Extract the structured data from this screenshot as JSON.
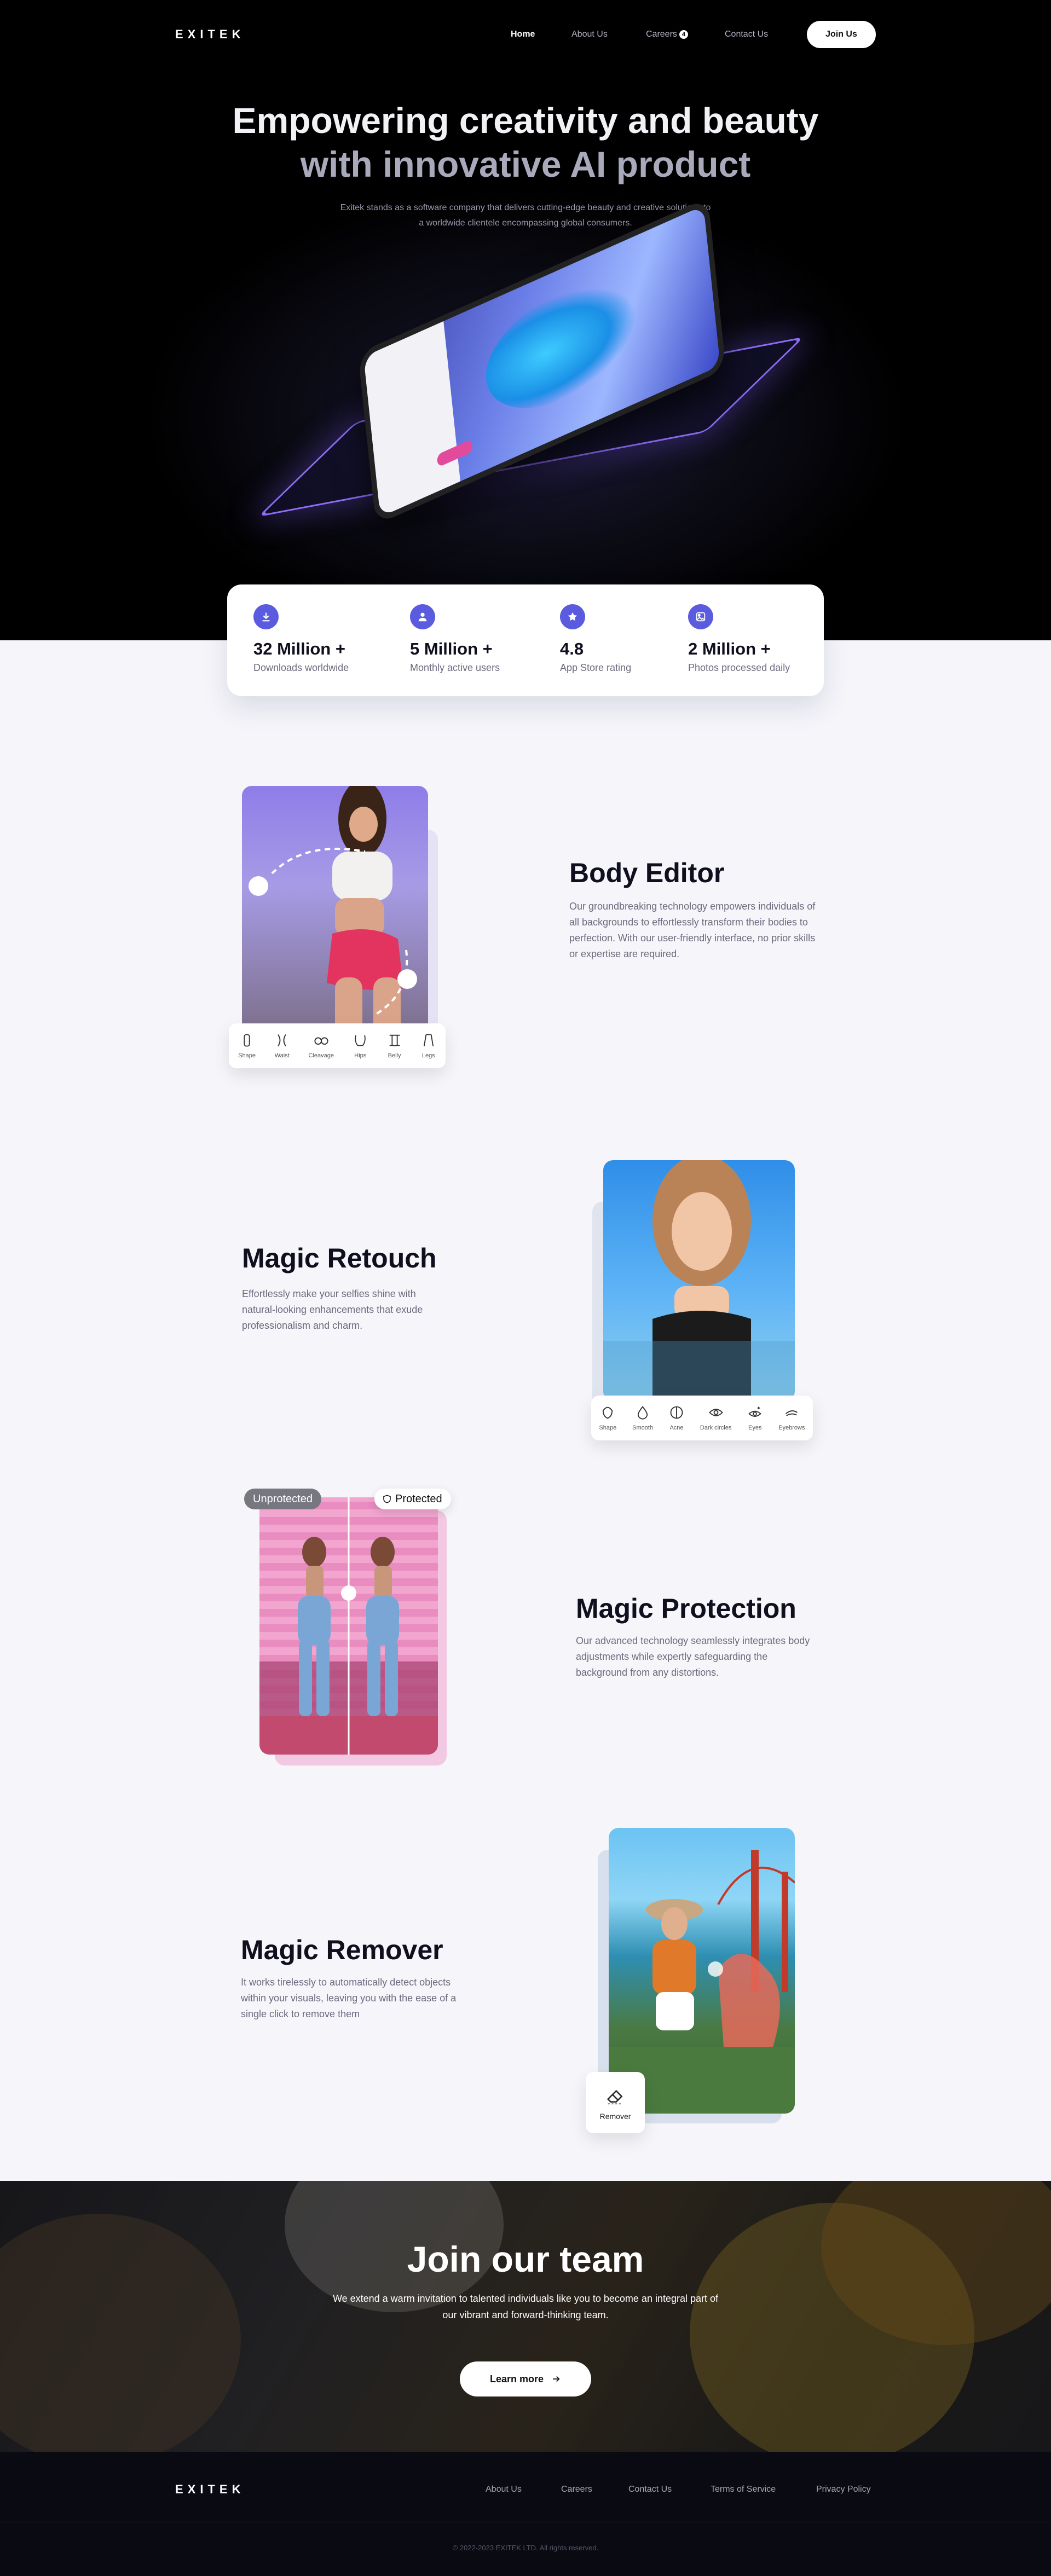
{
  "nav": {
    "logo": "EXITEK",
    "links": [
      "Home",
      "About Us",
      "Careers",
      "Contact Us"
    ],
    "careers_badge": "4",
    "cta": "Join Us"
  },
  "hero": {
    "title_line1": "Empowering creativity and beauty",
    "title_line2": "with innovative AI product",
    "subtitle": "Exitek stands as a software company that delivers cutting-edge beauty and creative solutions to a worldwide clientele encompassing global consumers."
  },
  "stats": [
    {
      "value": "32 Million +",
      "label": "Downloads worldwide",
      "icon": "download-icon"
    },
    {
      "value": "5 Million +",
      "label": "Monthly active users",
      "icon": "user-icon"
    },
    {
      "value": "4.8",
      "label": "App Store rating",
      "icon": "star-icon"
    },
    {
      "value": "2 Million +",
      "label": "Photos processed daily",
      "icon": "image-icon"
    }
  ],
  "body_editor": {
    "title": "Body Editor",
    "desc": "Our groundbreaking technology empowers individuals of all backgrounds to effortlessly transform their bodies to perfection. With our user-friendly interface, no prior skills or expertise are required.",
    "tools": [
      "Shape",
      "Waist",
      "Cleavage",
      "Hips",
      "Belly",
      "Legs"
    ]
  },
  "magic_retouch": {
    "title": "Magic Retouch",
    "desc": "Effortlessly make your selfies shine with natural-looking enhancements that exude professionalism and charm.",
    "tools": [
      "Shape",
      "Smooth",
      "Acne",
      "Dark circles",
      "Eyes",
      "Eyebrows"
    ]
  },
  "magic_protection": {
    "title": "Magic Protection",
    "desc": "Our advanced technology seamlessly integrates body adjustments while expertly safeguarding the background from any distortions.",
    "badge_left": "Unprotected",
    "badge_right": "Protected"
  },
  "magic_remover": {
    "title": "Magic Remover",
    "desc": "It works tirelessly to automatically detect objects within your visuals, leaving you with the ease of a single click to remove them",
    "tool_label": "Remover"
  },
  "join": {
    "title": "Join our team",
    "subtitle": "We extend a warm invitation to talented individuals like you to become an integral part of our vibrant and forward-thinking team.",
    "button": "Learn more"
  },
  "footer": {
    "logo": "EXITEK",
    "links": [
      "About Us",
      "Careers",
      "Contact Us",
      "Terms of Service",
      "Privacy Policy"
    ],
    "copyright": "© 2022-2023 EXITEK LTD. All rights reserved."
  },
  "colors": {
    "accent": "#5b5be0",
    "hero_bg": "#000000",
    "page_bg": "#f5f5fa",
    "footer_bg": "#0a0a12"
  }
}
